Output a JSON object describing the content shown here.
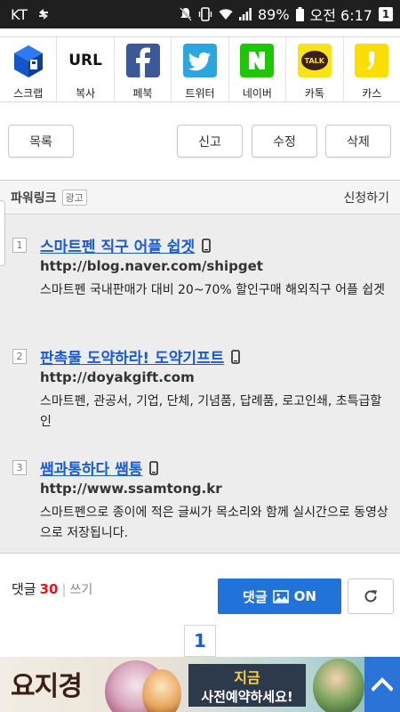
{
  "status_bar": {
    "carrier": "KT",
    "battery": "89%",
    "time": "오전 6:17",
    "notification_count": "1"
  },
  "share": [
    {
      "label": "스크랩",
      "icon": "scrap-icon"
    },
    {
      "label": "복사",
      "logo_text": "URL",
      "icon": "url-icon"
    },
    {
      "label": "페북",
      "icon": "facebook-icon",
      "color": "#3b5998"
    },
    {
      "label": "트위터",
      "icon": "twitter-icon",
      "color": "#2ca6e0"
    },
    {
      "label": "네이버",
      "icon": "naver-icon",
      "color": "#1ec800"
    },
    {
      "label": "카톡",
      "logo_text": "TALK",
      "icon": "kakaotalk-icon",
      "color": "#f7e317"
    },
    {
      "label": "카스",
      "icon": "kakaostory-icon",
      "color": "#f9de00"
    }
  ],
  "actions": {
    "list": "목록",
    "report": "신고",
    "edit": "수정",
    "delete": "삭제"
  },
  "powerlink": {
    "title": "파워링크",
    "tag": "광고",
    "apply": "신청하기",
    "ads": [
      {
        "num": "1",
        "title": "스마트펜 직구 어플 쉽겟",
        "url": "http://blog.naver.com/shipget",
        "desc": "스마트펜 국내판매가 대비 20~70% 할인구매 해외직구 어플 쉽겟"
      },
      {
        "num": "2",
        "title": "판촉물 도약하라! 도약기프트",
        "url": "http://doyakgift.com",
        "desc": "스마트펜, 관공서, 기업, 단체, 기념품, 답례품, 로고인쇄, 초특급할인"
      },
      {
        "num": "3",
        "title": "쌤과통하다 쌤통",
        "url": "http://www.ssamtong.kr",
        "desc": "스마트펜으로 종이에 적은 글씨가 목소리와 함께 실시간으로 동영상으로 저장됩니다."
      }
    ]
  },
  "comments": {
    "label": "댓글",
    "count": "30",
    "separator": "|",
    "write": "쓰기",
    "button_label": "댓글",
    "button_on": "ON"
  },
  "pagination": {
    "current": "1"
  },
  "banner": {
    "logo": "요지경",
    "line1": "지금",
    "line2": "사전예약하세요!"
  },
  "colors": {
    "link_blue": "#1a5bd1",
    "accent_blue": "#2173d9",
    "count_red": "#e0161e"
  }
}
